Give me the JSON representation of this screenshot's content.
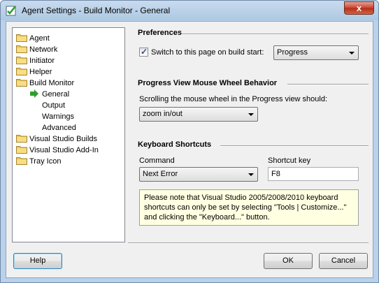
{
  "window": {
    "title": "Agent Settings - Build Monitor - General",
    "close_label": "x"
  },
  "tree": {
    "items": [
      {
        "label": "Agent",
        "type": "folder",
        "level": 0
      },
      {
        "label": "Network",
        "type": "folder",
        "level": 0
      },
      {
        "label": "Initiator",
        "type": "folder",
        "level": 0
      },
      {
        "label": "Helper",
        "type": "folder",
        "level": 0
      },
      {
        "label": "Build Monitor",
        "type": "folder-open",
        "level": 0
      },
      {
        "label": "General",
        "type": "selected-arrow",
        "level": 1
      },
      {
        "label": "Output",
        "type": "plain",
        "level": 1
      },
      {
        "label": "Warnings",
        "type": "plain",
        "level": 1
      },
      {
        "label": "Advanced",
        "type": "plain",
        "level": 1
      },
      {
        "label": "Visual Studio Builds",
        "type": "folder",
        "level": 0
      },
      {
        "label": "Visual Studio Add-In",
        "type": "folder",
        "level": 0
      },
      {
        "label": "Tray Icon",
        "type": "folder",
        "level": 0
      }
    ]
  },
  "preferences": {
    "title": "Preferences",
    "switch_label": "Switch to this page on build start:",
    "switch_checked": true,
    "start_page_value": "Progress"
  },
  "wheel": {
    "title": "Progress View Mouse Wheel Behavior",
    "prompt": "Scrolling the mouse wheel in the Progress view should:",
    "value": "zoom in/out"
  },
  "shortcuts": {
    "title": "Keyboard Shortcuts",
    "command_label": "Command",
    "command_value": "Next Error",
    "key_label": "Shortcut key",
    "key_value": "F8",
    "note": "Please note that Visual Studio 2005/2008/2010 keyboard shortcuts can only be set by selecting \"Tools | Customize...\" and clicking the \"Keyboard...\" button."
  },
  "buttons": {
    "help": "Help",
    "ok": "OK",
    "cancel": "Cancel"
  },
  "colors": {
    "folder": "#e8c65a",
    "arrow": "#2f9e2f",
    "note_bg": "#ffffe1"
  }
}
